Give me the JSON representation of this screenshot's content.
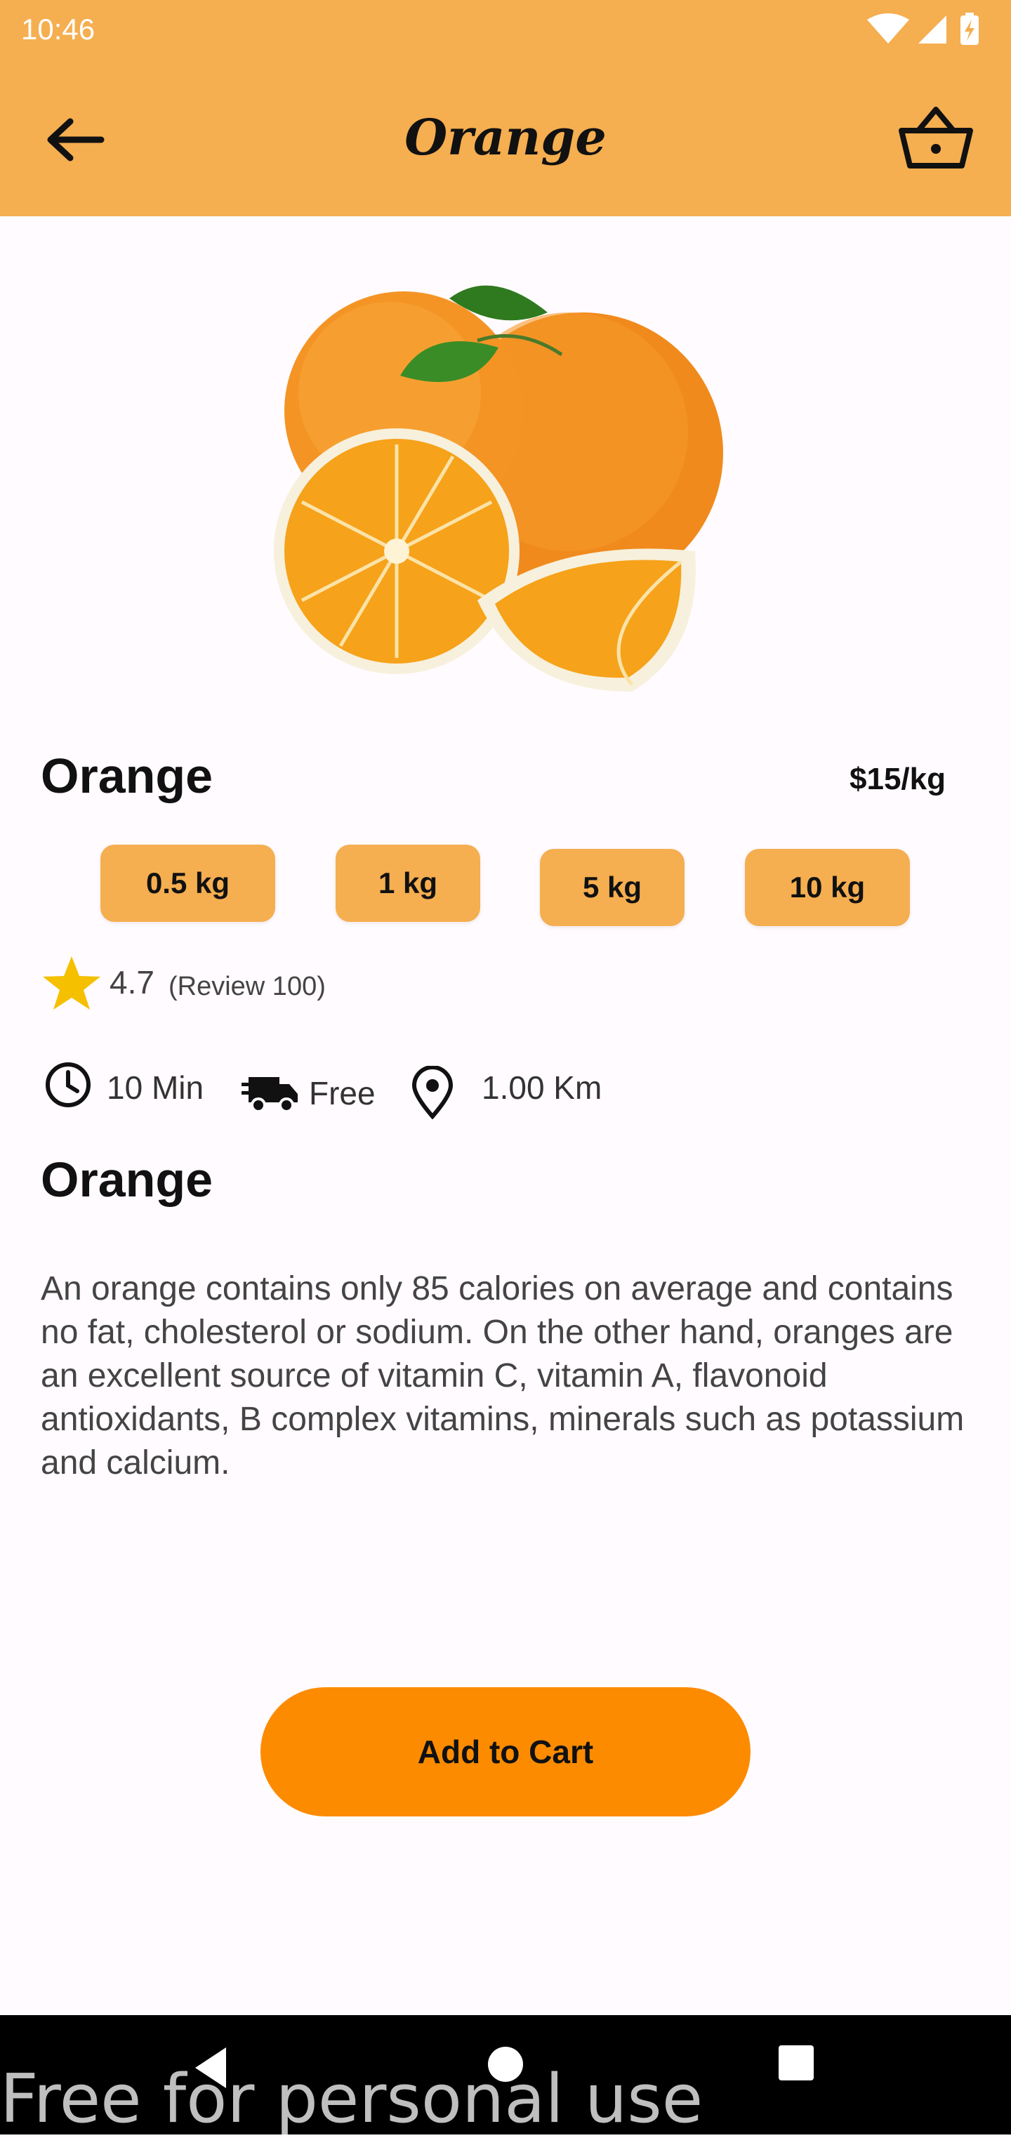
{
  "status_bar": {
    "time": "10:46"
  },
  "app_bar": {
    "title": "Orange"
  },
  "product": {
    "name": "Orange",
    "price": "$15/kg",
    "weights": [
      "0.5 kg",
      "1 kg",
      "5 kg",
      "10 kg"
    ],
    "rating": "4.7",
    "reviews": "(Review 100)"
  },
  "info": {
    "time": "10 Min",
    "delivery": "Free",
    "distance": "1.00 Km"
  },
  "section": {
    "title": "Orange",
    "description": "An orange contains only 85 calories on average and contains no fat, cholesterol or sodium. On the other hand, oranges are an excellent source of vitamin C, vitamin A, flavonoid antioxidants, B complex vitamins, minerals such as potassium and calcium."
  },
  "actions": {
    "add_to_cart": "Add to Cart"
  },
  "watermark": "Free for personal use",
  "colors": {
    "app_bar": "#f5ae50",
    "chip": "#f5ae50",
    "primary_button": "#fd8b00",
    "star": "#f5c000"
  }
}
